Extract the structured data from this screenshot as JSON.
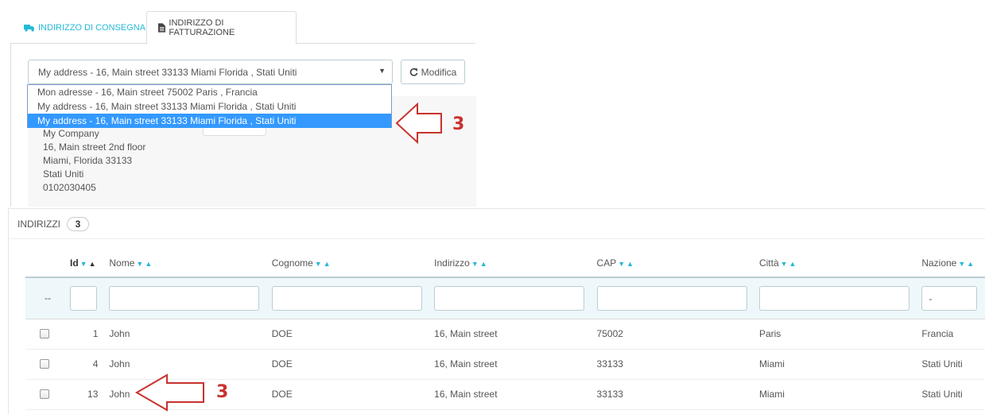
{
  "tabs": {
    "delivery_label": "INDIRIZZO DI CONSEGNA",
    "invoice_label": "INDIRIZZO DI FATTURAZIONE"
  },
  "address_select": {
    "value": "My address - 16, Main street 33133 Miami Florida , Stati Uniti",
    "options": [
      "Mon adresse - 16, Main street 75002 Paris , Francia",
      "My address - 16, Main street 33133 Miami Florida , Stati Uniti",
      "My address - 16, Main street 33133 Miami Florida , Stati Uniti"
    ],
    "selected_index": 2
  },
  "edit_button_label": "Modifica",
  "address_details": {
    "company": "My Company",
    "street": "16, Main street 2nd floor",
    "city": "Miami, Florida 33133",
    "country": "Stati Uniti",
    "phone": "0102030405"
  },
  "annotations": {
    "dropdown_number": "3",
    "table_number": "3"
  },
  "list": {
    "title": "INDIRIZZI",
    "count": "3",
    "columns": [
      "Id",
      "Nome",
      "Cognome",
      "Indirizzo",
      "CAP",
      "Città",
      "Nazione"
    ],
    "filter_checkbox_placeholder": "--",
    "filter_country_value": "-",
    "rows": [
      {
        "id": "1",
        "nome": "John",
        "cognome": "DOE",
        "indirizzo": "16, Main street",
        "cap": "75002",
        "citta": "Paris",
        "nazione": "Francia"
      },
      {
        "id": "4",
        "nome": "John",
        "cognome": "DOE",
        "indirizzo": "16, Main street",
        "cap": "33133",
        "citta": "Miami",
        "nazione": "Stati Uniti"
      },
      {
        "id": "13",
        "nome": "John",
        "cognome": "DOE",
        "indirizzo": "16, Main street",
        "cap": "33133",
        "citta": "Miami",
        "nazione": "Stati Uniti"
      }
    ]
  },
  "colors": {
    "accent": "#25b9d7",
    "selected_option": "#3399ff",
    "annotation": "#c8322d"
  }
}
